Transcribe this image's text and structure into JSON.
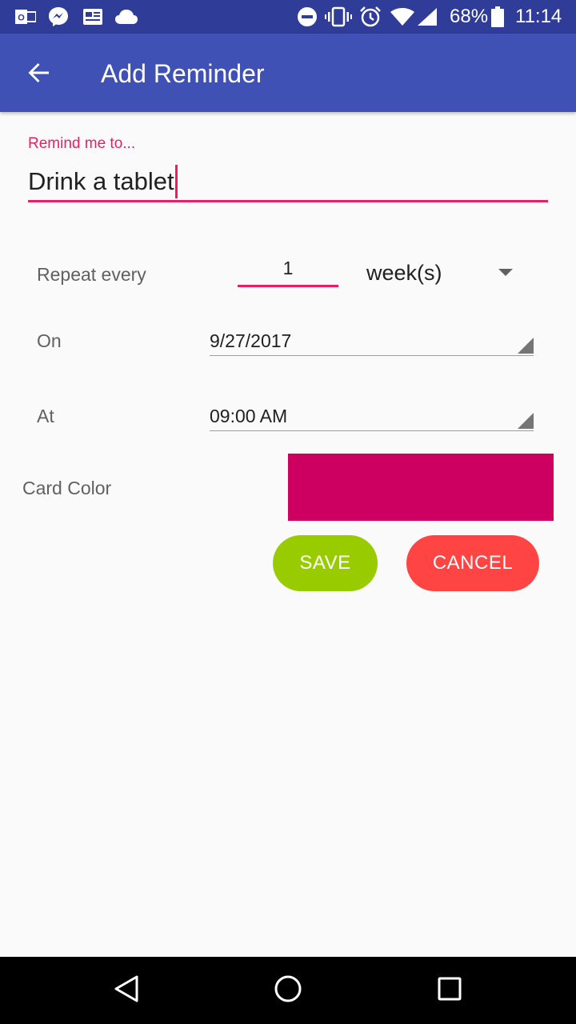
{
  "status_bar": {
    "battery": "68%",
    "time": "11:14",
    "icons": [
      "outlook-icon",
      "messenger-icon",
      "news-icon",
      "cloud-icon",
      "do-not-disturb-icon",
      "vibrate-icon",
      "alarm-icon",
      "wifi-icon",
      "cell-signal-icon",
      "battery-icon"
    ]
  },
  "app_bar": {
    "title": "Add Reminder",
    "back_icon": "arrow-back-icon"
  },
  "form": {
    "title_field": {
      "label": "Remind me to...",
      "value": "Drink a tablet"
    },
    "repeat": {
      "label": "Repeat every",
      "value": "1",
      "unit": "week(s)"
    },
    "on": {
      "label": "On",
      "value": "9/27/2017"
    },
    "at": {
      "label": "At",
      "value": "09:00 AM"
    },
    "card_color": {
      "label": "Card Color",
      "color": "#cd0062"
    }
  },
  "buttons": {
    "save": {
      "label": "SAVE",
      "color": "#99cc00"
    },
    "cancel": {
      "label": "CANCEL",
      "color": "#ff4444"
    }
  },
  "colors": {
    "status_bar": "#2f3d99",
    "app_bar": "#3f51b5",
    "accent": "#e91e63",
    "background": "#fafafa"
  },
  "nav_bar": {
    "icons": [
      "nav-back-icon",
      "nav-home-icon",
      "nav-recents-icon"
    ]
  }
}
